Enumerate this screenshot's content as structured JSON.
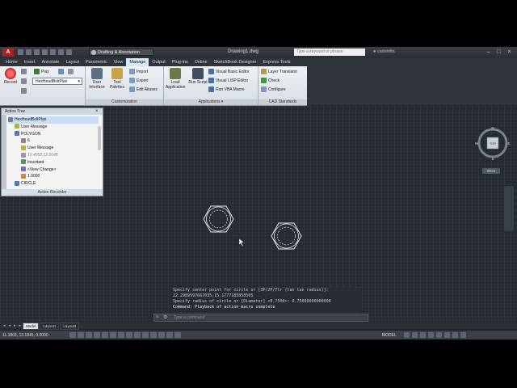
{
  "window": {
    "workspace": "Drafting & Annotation",
    "document_title": "Drawing1.dwg",
    "search_placeholder": "Type a keyword or phrase",
    "user": "cadshifts"
  },
  "tabs": [
    "Home",
    "Insert",
    "Annotate",
    "Layout",
    "Parametric",
    "View",
    "Manage",
    "Output",
    "Plug-ins",
    "Online",
    "SketchBook Designer",
    "Express Tools"
  ],
  "active_tab": "Manage",
  "ribbon": {
    "action_recorder": {
      "record_label": "Record",
      "play_label": "Play",
      "macro_selected": "HexHeadBoltPlan"
    },
    "customization": {
      "title": "Customization",
      "user_interface": "User Interface",
      "tool_palettes": "Tool Palettes",
      "import": "Import",
      "export": "Export",
      "edit_aliases": "Edit Aliases"
    },
    "applications": {
      "title": "Applications",
      "load_application": "Load Application",
      "run_script": "Run Script",
      "vb_editor": "Visual Basic Editor",
      "lisp_editor": "Visual LISP Editor",
      "run_vba": "Run VBA Macro"
    },
    "cad_standards": {
      "title": "CAD Standards",
      "layer_translator": "Layer Translator",
      "check": "Check",
      "configure": "Configure"
    }
  },
  "action_tree": {
    "title": "Action Tree",
    "footer": "Action Recorder",
    "nodes": [
      {
        "label": "HexHeadBoltPlan",
        "indent": 0,
        "style": "sel"
      },
      {
        "label": "User Message",
        "indent": 1,
        "style": ""
      },
      {
        "label": "POLYGON",
        "indent": 1,
        "style": ""
      },
      {
        "label": "6",
        "indent": 2,
        "style": ""
      },
      {
        "label": "User Message",
        "indent": 2,
        "style": ""
      },
      {
        "label": "10.4052,12.5048",
        "indent": 2,
        "style": "gray"
      },
      {
        "label": "Inscribed",
        "indent": 2,
        "style": ""
      },
      {
        "label": "<View Change>",
        "indent": 2,
        "style": ""
      },
      {
        "label": "1.0000",
        "indent": 2,
        "style": ""
      },
      {
        "label": "CIRCLE",
        "indent": 1,
        "style": ""
      }
    ]
  },
  "viewcube": {
    "top": "TOP",
    "n": "N",
    "s": "S",
    "e": "E",
    "w": "W",
    "wcs": "WCS"
  },
  "command_history": [
    "Specify center point for circle or [3P/2P/Ttr (tan tan radius)]:",
    "22.2989597667035,15.1777185858505",
    "Specify radius of circle or [Diameter] <0.7500>: 0.75000000000000",
    "Command: Playback of action macro complete"
  ],
  "command_prompt": "Type a command",
  "layout_tabs": [
    "Model",
    "Layout1",
    "Layout2"
  ],
  "status": {
    "coords": "11.1803, 13.1845, 0.0000",
    "model_label": "MODEL"
  },
  "colors": {
    "background": "#262b31",
    "ribbon": "#e4e9ee",
    "accent": "#d6e8f6"
  }
}
